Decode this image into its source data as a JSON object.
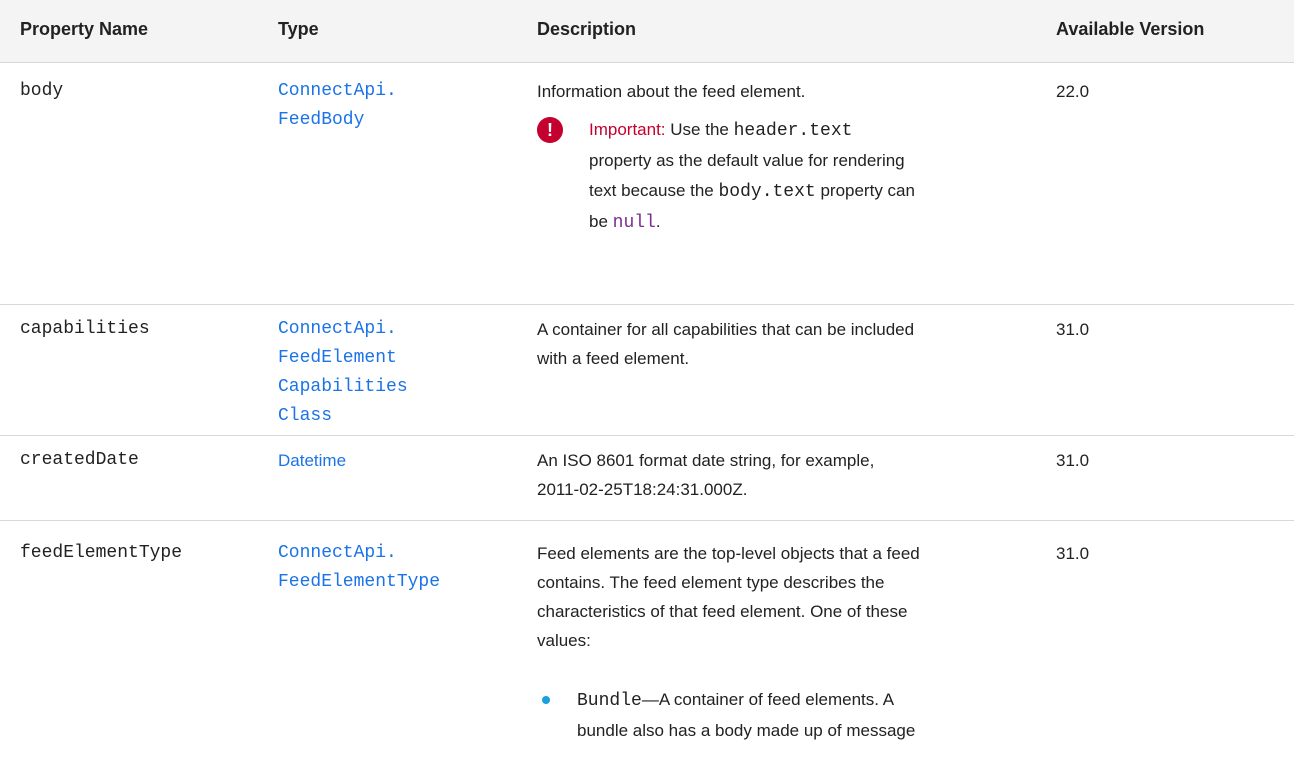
{
  "headers": {
    "property_name": "Property Name",
    "type": "Type",
    "description": "Description",
    "available_version": "Available Version"
  },
  "rows": {
    "body": {
      "name": "body",
      "type_line1": "ConnectApi.",
      "type_line2": "FeedBody",
      "description": "Information about the feed element.",
      "version": "22.0",
      "important": {
        "label": "Important:",
        "text1": "Use the",
        "code1": "header.text",
        "text2": "property as the default value for rendering",
        "text3": "text because the",
        "code2": "body.text",
        "text4": "property can",
        "text5": "be",
        "code3": "null",
        "text6": "."
      }
    },
    "capabilities": {
      "name": "capabilities",
      "type_line1": "ConnectApi.",
      "type_line2": "FeedElement",
      "type_line3": "Capabilities",
      "type_line4": "Class",
      "description_line1": "A container for all capabilities that can be included",
      "description_line2": "with a feed element.",
      "version": "31.0"
    },
    "createdDate": {
      "name": "createdDate",
      "type": "Datetime",
      "description_line1": "An ISO 8601 format date string, for example,",
      "description_line2": "2011-02-25T18:24:31.000Z.",
      "version": "31.0"
    },
    "feedElementType": {
      "name": "feedElementType",
      "type_line1": "ConnectApi.",
      "type_line2": "FeedElementType",
      "description_line1": "Feed elements are the top-level objects that a feed",
      "description_line2": "contains. The feed element type describes the",
      "description_line3": "characteristics of that feed element. One of these",
      "description_line4": "values:",
      "version": "31.0",
      "bullet": {
        "code": "Bundle",
        "text_line1": "—A container of feed elements. A",
        "text_line2": "bundle also has a body made up of message"
      }
    }
  },
  "colors": {
    "link": "#1a73e8",
    "important": "#c4002f",
    "null_code": "#7b2f8c",
    "bullet": "#1a9fe0"
  }
}
